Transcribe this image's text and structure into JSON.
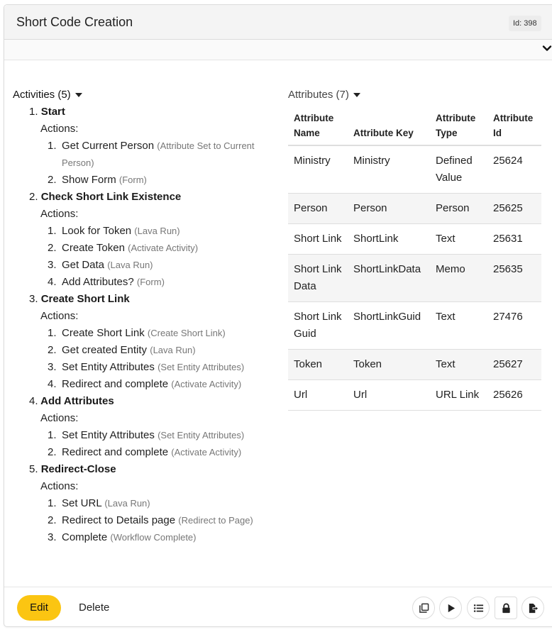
{
  "header": {
    "title": "Short Code Creation",
    "id_badge": "Id: 398"
  },
  "activities": {
    "label": "Activities (5)",
    "actions_label": "Actions:",
    "items": [
      {
        "num": "1.",
        "name": "Start",
        "actions": [
          {
            "num": "1.",
            "name": "Get Current Person",
            "type": "(Attribute Set to Current Person)"
          },
          {
            "num": "2.",
            "name": "Show Form",
            "type": "(Form)"
          }
        ]
      },
      {
        "num": "2.",
        "name": "Check Short Link Existence",
        "actions": [
          {
            "num": "1.",
            "name": "Look for Token",
            "type": "(Lava Run)"
          },
          {
            "num": "2.",
            "name": "Create Token",
            "type": "(Activate Activity)"
          },
          {
            "num": "3.",
            "name": "Get Data",
            "type": "(Lava Run)"
          },
          {
            "num": "4.",
            "name": "Add Attributes?",
            "type": "(Form)"
          }
        ]
      },
      {
        "num": "3.",
        "name": "Create Short Link",
        "actions": [
          {
            "num": "1.",
            "name": "Create Short Link",
            "type": "(Create Short Link)"
          },
          {
            "num": "2.",
            "name": "Get created Entity",
            "type": "(Lava Run)"
          },
          {
            "num": "3.",
            "name": "Set Entity Attributes",
            "type": "(Set Entity Attributes)"
          },
          {
            "num": "4.",
            "name": "Redirect and complete",
            "type": "(Activate Activity)"
          }
        ]
      },
      {
        "num": "4.",
        "name": "Add Attributes",
        "actions": [
          {
            "num": "1.",
            "name": "Set Entity Attributes",
            "type": "(Set Entity Attributes)"
          },
          {
            "num": "2.",
            "name": "Redirect and complete",
            "type": "(Activate Activity)"
          }
        ]
      },
      {
        "num": "5.",
        "name": "Redirect-Close",
        "actions": [
          {
            "num": "1.",
            "name": "Set URL",
            "type": "(Lava Run)"
          },
          {
            "num": "2.",
            "name": "Redirect to Details page",
            "type": "(Redirect to Page)"
          },
          {
            "num": "3.",
            "name": "Complete",
            "type": "(Workflow Complete)"
          }
        ]
      }
    ]
  },
  "attributes": {
    "label": "Attributes (7)",
    "columns": [
      "Attribute Name",
      "Attribute Key",
      "Attribute Type",
      "Attribute Id"
    ],
    "rows": [
      [
        "Ministry",
        "Ministry",
        "Defined Value",
        "25624"
      ],
      [
        "Person",
        "Person",
        "Person",
        "25625"
      ],
      [
        "Short Link",
        "ShortLink",
        "Text",
        "25631"
      ],
      [
        "Short Link Data",
        "ShortLinkData",
        "Memo",
        "25635"
      ],
      [
        "Short Link Guid",
        "ShortLinkGuid",
        "Text",
        "27476"
      ],
      [
        "Token",
        "Token",
        "Text",
        "25627"
      ],
      [
        "Url",
        "Url",
        "URL Link",
        "25626"
      ]
    ]
  },
  "footer": {
    "edit_label": "Edit",
    "delete_label": "Delete",
    "icons": [
      "copy-icon",
      "play-icon",
      "list-icon",
      "lock-icon",
      "export-icon"
    ]
  },
  "colors": {
    "accent": "#fbc512",
    "header_bg": "#f4f4f4",
    "stripe": "#f5f5f5"
  }
}
